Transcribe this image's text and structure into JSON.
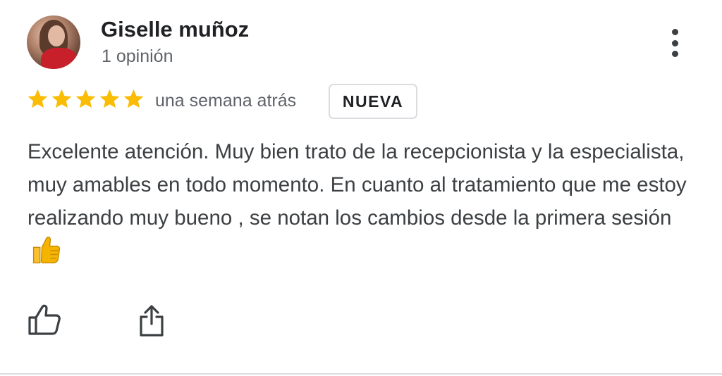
{
  "review": {
    "author_name": "Giselle muñoz",
    "author_reviews": "1 opinión",
    "rating": 5,
    "rating_max": 5,
    "time_ago": "una semana atrás",
    "badge": "NUEVA",
    "text": "Excelente atención. Muy bien trato de la recepcionista y la especialista, muy amables en todo momento. En cuanto al tratamiento que me estoy realizando muy bueno , se notan los cambios desde la primera sesión",
    "emoji": "thumbs-up-emoji"
  },
  "icons": {
    "more": "more-vert-icon",
    "like": "thumb-up-outline-icon",
    "share": "share-icon",
    "star": "star-icon"
  },
  "colors": {
    "star": "#fbbc04",
    "text": "#3c4043",
    "secondary": "#5f6368",
    "border": "#dadce0"
  }
}
